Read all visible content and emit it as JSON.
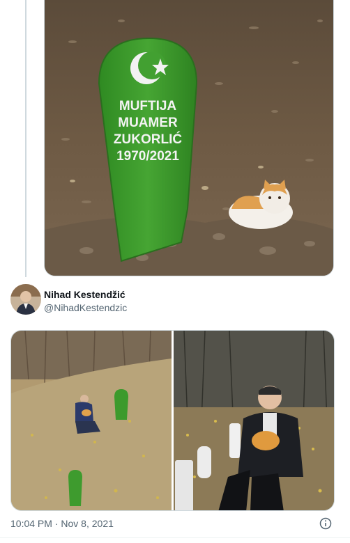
{
  "tweet": {
    "author_name": "Nihad Kestendžić",
    "author_handle": "@NihadKestendzic",
    "timestamp": "10:04 PM",
    "date": "Nov 8, 2021",
    "separator": "·"
  },
  "grave_marker": {
    "line1": "MUFTIJA",
    "line2": "MUAMER",
    "line3": "ZUKORLIĆ",
    "line4": "1970/2021"
  },
  "icons": {
    "info": "info-icon",
    "crescent": "crescent-star-icon"
  },
  "colors": {
    "text_primary": "#0f1419",
    "text_secondary": "#536471",
    "border": "#cfd9de",
    "marker_green": "#3f9a2e"
  }
}
